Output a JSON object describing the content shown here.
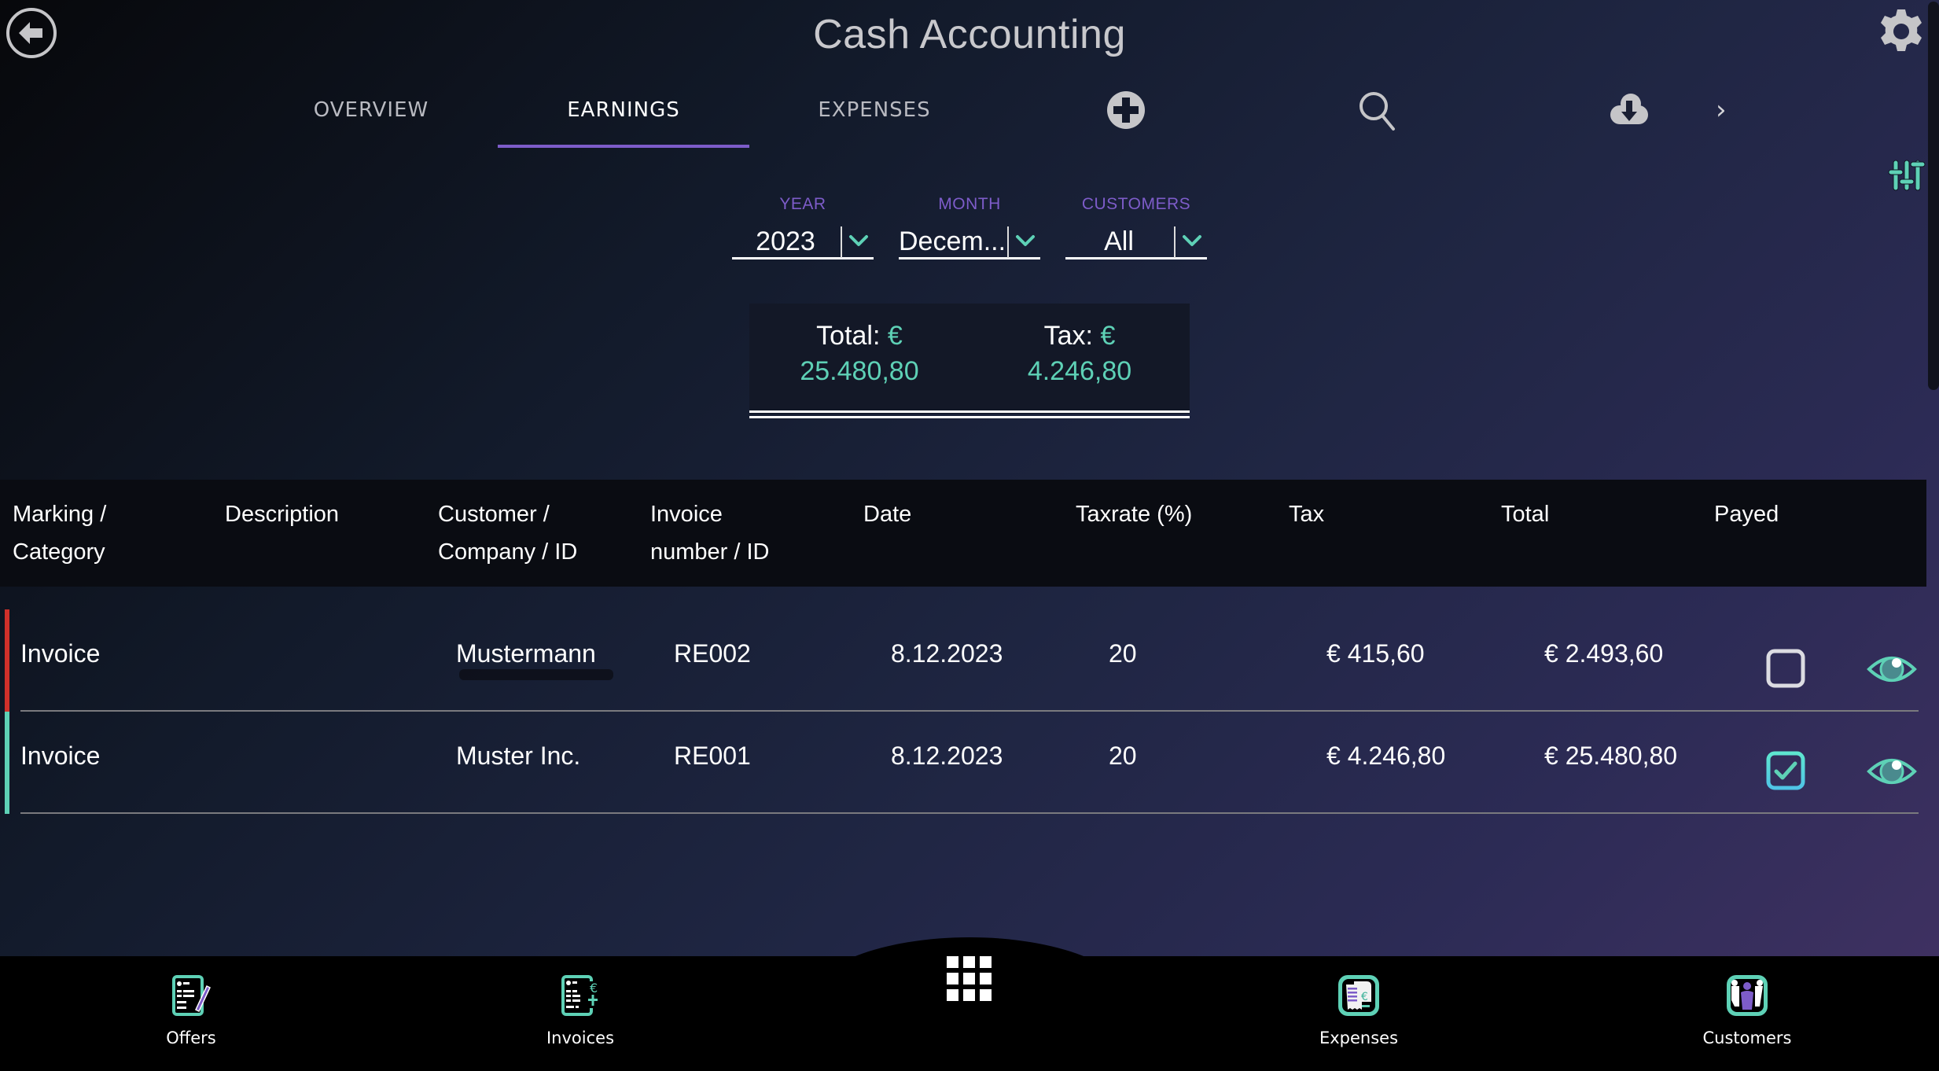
{
  "header": {
    "title": "Cash Accounting",
    "back_icon": "back-arrow-circle-icon",
    "settings_icon": "gear-icon"
  },
  "tabs": [
    {
      "label": "OVERVIEW",
      "active": false
    },
    {
      "label": "EARNINGS",
      "active": true
    },
    {
      "label": "EXPENSES",
      "active": false
    }
  ],
  "toolbar": {
    "add_icon": "plus-circle-icon",
    "search_icon": "search-icon",
    "download_icon": "cloud-download-icon",
    "more_icon": "chevron-right-icon",
    "more_label": "›",
    "filter_icon": "sliders-icon"
  },
  "filters": {
    "year": {
      "label": "YEAR",
      "value": "2023"
    },
    "month": {
      "label": "MONTH",
      "value": "Decem..."
    },
    "customers": {
      "label": "CUSTOMERS",
      "value": "All"
    }
  },
  "summary": {
    "total_label": "Total:",
    "total_currency": "€",
    "total_value": "25.480,80",
    "tax_label": "Tax:",
    "tax_currency": "€",
    "tax_value": "4.246,80"
  },
  "table": {
    "columns": [
      {
        "line1": "Marking /",
        "line2": "Category"
      },
      {
        "line1": "Description",
        "line2": ""
      },
      {
        "line1": "Customer /",
        "line2": "Company / ID"
      },
      {
        "line1": "Invoice",
        "line2": "number / ID"
      },
      {
        "line1": "Date",
        "line2": ""
      },
      {
        "line1": "Taxrate (%)",
        "line2": ""
      },
      {
        "line1": "Tax",
        "line2": ""
      },
      {
        "line1": "Total",
        "line2": ""
      },
      {
        "line1": "Payed",
        "line2": ""
      }
    ],
    "rows": [
      {
        "marking_color": "#d0302a",
        "category": "Invoice",
        "description": "",
        "customer": "Mustermann",
        "invoice_number": "RE002",
        "date": "8.12.2023",
        "taxrate": "20",
        "tax": "€ 415,60",
        "total": "€ 2.493,60",
        "payed": false
      },
      {
        "marking_color": "#5ed1b6",
        "category": "Invoice",
        "description": "",
        "customer": "Muster Inc.",
        "invoice_number": "RE001",
        "date": "8.12.2023",
        "taxrate": "20",
        "tax": "€ 4.246,80",
        "total": "€ 25.480,80",
        "payed": true
      }
    ]
  },
  "bottom_nav": {
    "items": [
      {
        "label": "Offers",
        "icon": "offers-document-pen-icon"
      },
      {
        "label": "Invoices",
        "icon": "invoice-euro-plus-icon"
      },
      {
        "label": "Expenses",
        "icon": "receipt-euro-icon"
      },
      {
        "label": "Customers",
        "icon": "customers-people-icon"
      }
    ],
    "center_icon": "apps-grid-icon"
  },
  "colors": {
    "accent_teal": "#5ed1b6",
    "accent_purple": "#7d5cc9",
    "unpaid_marker": "#d0302a"
  }
}
